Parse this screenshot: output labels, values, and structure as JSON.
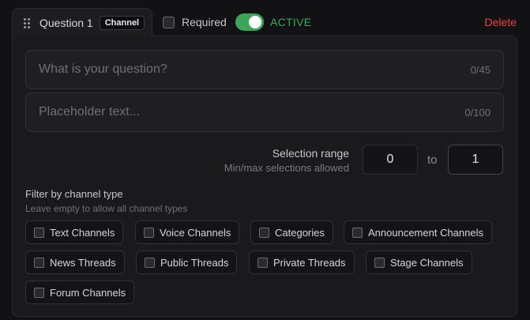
{
  "header": {
    "question_title": "Question 1",
    "badge": "Channel",
    "required_label": "Required",
    "required_checked": false,
    "active_toggle_on": true,
    "active_label": "ACTIVE",
    "delete_label": "Delete"
  },
  "fields": {
    "question": {
      "placeholder": "What is your question?",
      "value": "",
      "counter": "0/45"
    },
    "placeholder_text": {
      "placeholder": "Placeholder text...",
      "value": "",
      "counter": "0/100"
    }
  },
  "selection_range": {
    "title": "Selection range",
    "subtitle": "Min/max selections allowed",
    "min": "0",
    "to_label": "to",
    "max": "1"
  },
  "filter": {
    "title": "Filter by channel type",
    "subtitle": "Leave empty to allow all channel types",
    "options": [
      {
        "label": "Text Channels",
        "checked": false
      },
      {
        "label": "Voice Channels",
        "checked": false
      },
      {
        "label": "Categories",
        "checked": false
      },
      {
        "label": "Announcement Channels",
        "checked": false
      },
      {
        "label": "News Threads",
        "checked": false
      },
      {
        "label": "Public Threads",
        "checked": false
      },
      {
        "label": "Private Threads",
        "checked": false
      },
      {
        "label": "Stage Channels",
        "checked": false
      },
      {
        "label": "Forum Channels",
        "checked": false
      }
    ]
  },
  "colors": {
    "accent_green": "#3ba55c",
    "danger_red": "#ed4245",
    "background": "#121214",
    "panel": "#1a1a1d"
  }
}
